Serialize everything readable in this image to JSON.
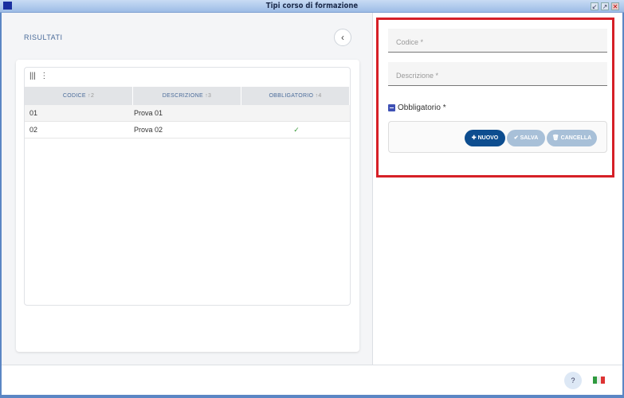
{
  "window": {
    "title": "Tipi corso di formazione"
  },
  "left": {
    "section_title": "RISULTATI",
    "table": {
      "columns": [
        {
          "label": "CODICE",
          "sort": "↑2"
        },
        {
          "label": "DESCRIZIONE",
          "sort": "↑3"
        },
        {
          "label": "OBBLIGATORIO",
          "sort": "↑4"
        }
      ],
      "rows": [
        {
          "codice": "01",
          "descrizione": "Prova 01",
          "obbligatorio": ""
        },
        {
          "codice": "02",
          "descrizione": "Prova 02",
          "obbligatorio": "✓"
        }
      ]
    }
  },
  "form": {
    "codice_placeholder": "Codice *",
    "descrizione_placeholder": "Descrizione *",
    "obbligatorio_label": "Obbligatorio *",
    "buttons": {
      "nuovo": "NUOVO",
      "salva": "SALVA",
      "cancella": "CANCELLA"
    }
  },
  "footer": {
    "help": "?"
  },
  "colors": {
    "primary": "#0d4d8f",
    "disabled": "#a8c0d8",
    "highlight": "#d62027"
  }
}
